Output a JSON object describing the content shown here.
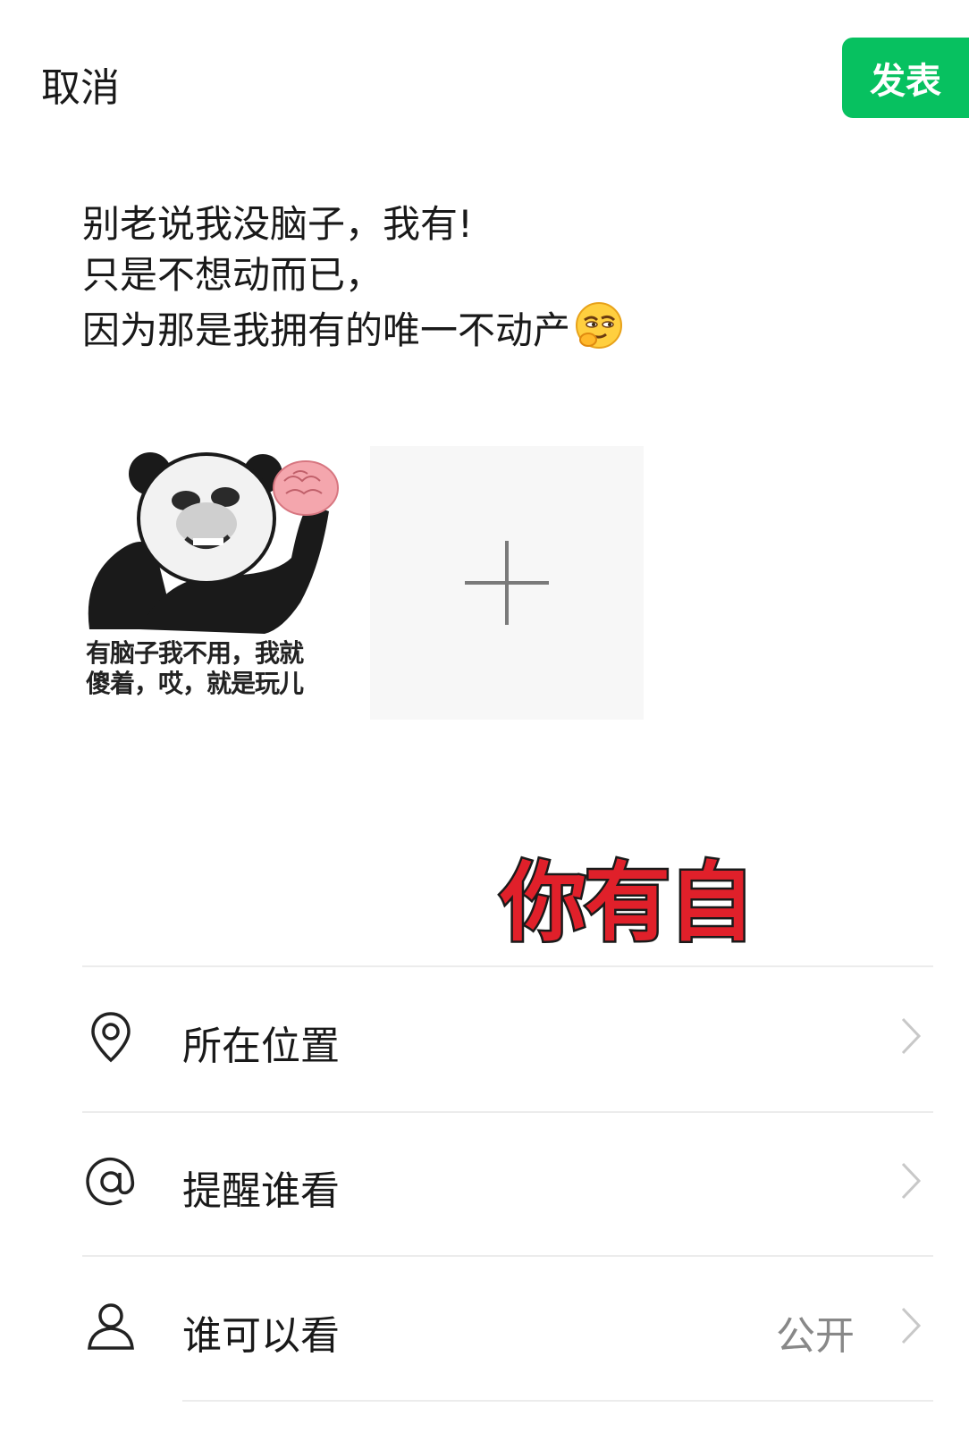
{
  "header": {
    "cancel_label": "取消",
    "publish_label": "发表",
    "accent_color": "#07c160"
  },
  "post": {
    "lines": [
      "别老说我没脑子，我有!",
      "只是不想动而已，",
      "因为那是我拥有的唯一不动产"
    ],
    "trailing_emoji": "smirk-thinking-emoji"
  },
  "media": {
    "meme_caption": "有脑子我不用，我就\n傻着，哎，就是玩儿",
    "add_icon": "plus-icon"
  },
  "overlay_text": "你有自",
  "options": [
    {
      "icon": "location-pin-icon",
      "label": "所在位置",
      "value": ""
    },
    {
      "icon": "at-sign-icon",
      "label": "提醒谁看",
      "value": ""
    },
    {
      "icon": "person-icon",
      "label": "谁可以看",
      "value": "公开"
    }
  ]
}
